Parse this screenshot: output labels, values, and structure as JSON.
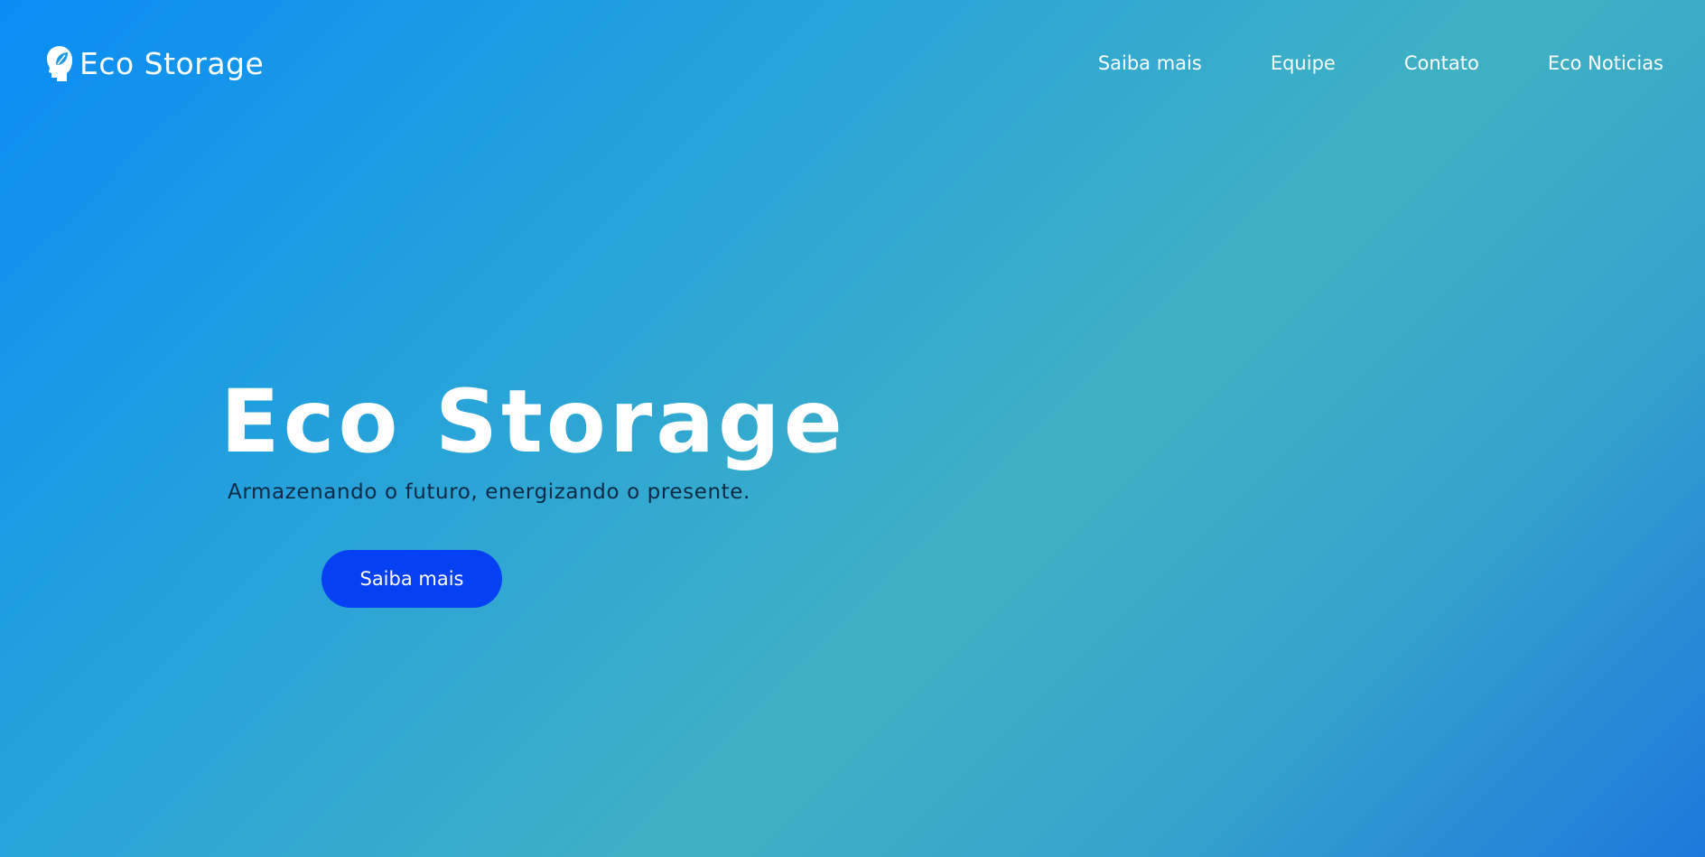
{
  "header": {
    "brand": {
      "name": "Eco Storage",
      "icon": "head-leaf-icon"
    },
    "nav": [
      {
        "label": "Saiba mais"
      },
      {
        "label": "Equipe"
      },
      {
        "label": "Contato"
      },
      {
        "label": "Eco Noticias"
      }
    ]
  },
  "hero": {
    "title": "Eco Storage",
    "subtitle": "Armazenando o futuro, energizando o presente.",
    "cta_label": "Saiba mais"
  },
  "colors": {
    "gradient_start": "#0a8cf5",
    "gradient_mid": "#3fb1c3",
    "gradient_end": "#1e78dc",
    "button": "#0540f2",
    "subtitle_text": "#0d2a45",
    "text": "#ffffff"
  }
}
